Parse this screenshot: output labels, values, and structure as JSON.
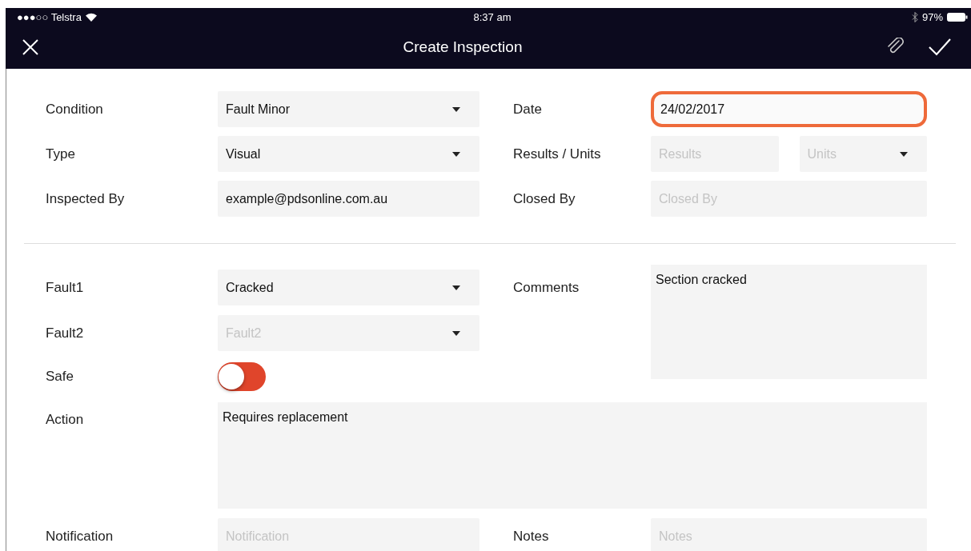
{
  "status_bar": {
    "carrier": "●●●○○ Telstra",
    "time": "8:37 am",
    "battery": "97%"
  },
  "header": {
    "title": "Create Inspection"
  },
  "form": {
    "condition": {
      "label": "Condition",
      "kind": "dropdown",
      "value": "Fault Minor"
    },
    "date": {
      "label": "Date",
      "kind": "text",
      "value": "24/02/2017",
      "highlighted": true
    },
    "type": {
      "label": "Type",
      "kind": "dropdown",
      "value": "Visual"
    },
    "results_units": {
      "label": "Results / Units",
      "results": {
        "kind": "text",
        "placeholder": "Results"
      },
      "units": {
        "kind": "dropdown",
        "placeholder": "Units"
      }
    },
    "inspected_by": {
      "label": "Inspected By",
      "kind": "text",
      "value": "example@pdsonline.com.au"
    },
    "closed_by": {
      "label": "Closed By",
      "kind": "text",
      "placeholder": "Closed By"
    },
    "fault1": {
      "label": "Fault1",
      "kind": "dropdown",
      "value": "Cracked"
    },
    "comments": {
      "label": "Comments",
      "kind": "textarea",
      "value": "Section cracked"
    },
    "fault2": {
      "label": "Fault2",
      "kind": "dropdown",
      "placeholder": "Fault2"
    },
    "safe": {
      "label": "Safe",
      "on": false
    },
    "action": {
      "label": "Action",
      "kind": "textarea",
      "value": "Requires replacement"
    },
    "notification": {
      "label": "Notification",
      "kind": "text",
      "placeholder": "Notification"
    },
    "notes": {
      "label": "Notes",
      "kind": "text",
      "placeholder": "Notes"
    }
  }
}
